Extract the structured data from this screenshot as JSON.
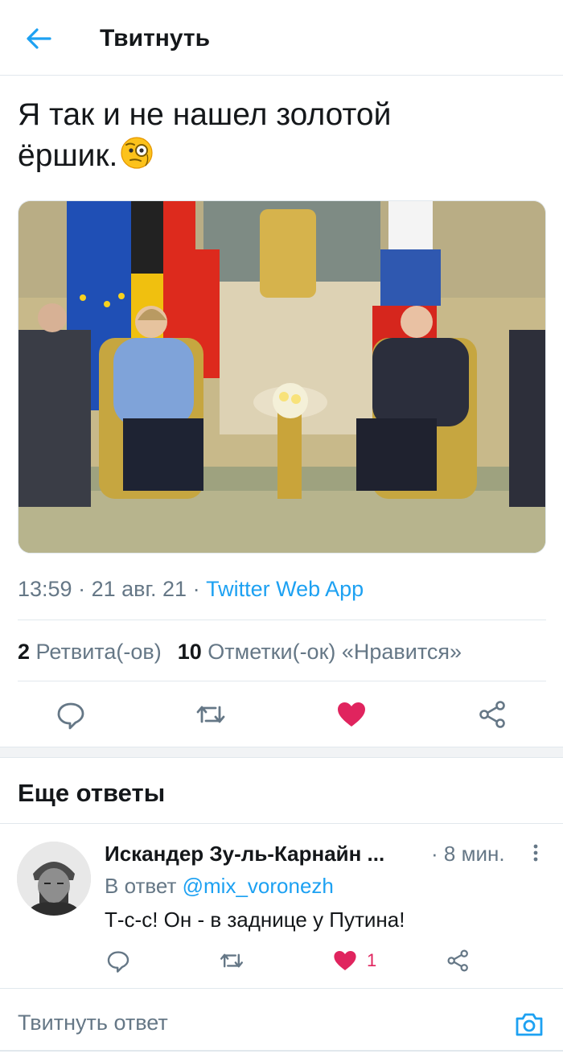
{
  "header": {
    "title": "Твитнуть"
  },
  "tweet": {
    "text_line1": "Я так и не нашел золотой",
    "text_line2": "ёршик."
  },
  "meta": {
    "time": "13:59",
    "date": "21 авг. 21",
    "separator": " · ",
    "source": "Twitter Web App"
  },
  "stats": {
    "retweets_count": "2",
    "retweets_label": "Ретвита(-ов)",
    "likes_count": "10",
    "likes_label": "Отметки(-ок) «Нравится»"
  },
  "more_replies": {
    "title": "Еще ответы"
  },
  "reply": {
    "name": "Искандер Зу-ль-Карнайн ...",
    "time": "· 8 мин.",
    "reply_to_label": "В ответ",
    "reply_to_handle": "@mix_voronezh",
    "text": "Т-с-с! Он - в заднице у Путина!",
    "like_count": "1"
  },
  "compose": {
    "placeholder": "Твитнуть ответ"
  },
  "colors": {
    "accent": "#1da1f2",
    "like": "#e0245e",
    "secondary_text": "#657786",
    "primary_text": "#14171a"
  },
  "icons": {
    "back": "arrow-left-icon",
    "reply": "speech-bubble-icon",
    "retweet": "retweet-icon",
    "like": "heart-icon",
    "share": "share-icon",
    "camera": "camera-icon",
    "more": "vertical-dots-icon",
    "emoji": "face-with-monocle-emoji"
  }
}
